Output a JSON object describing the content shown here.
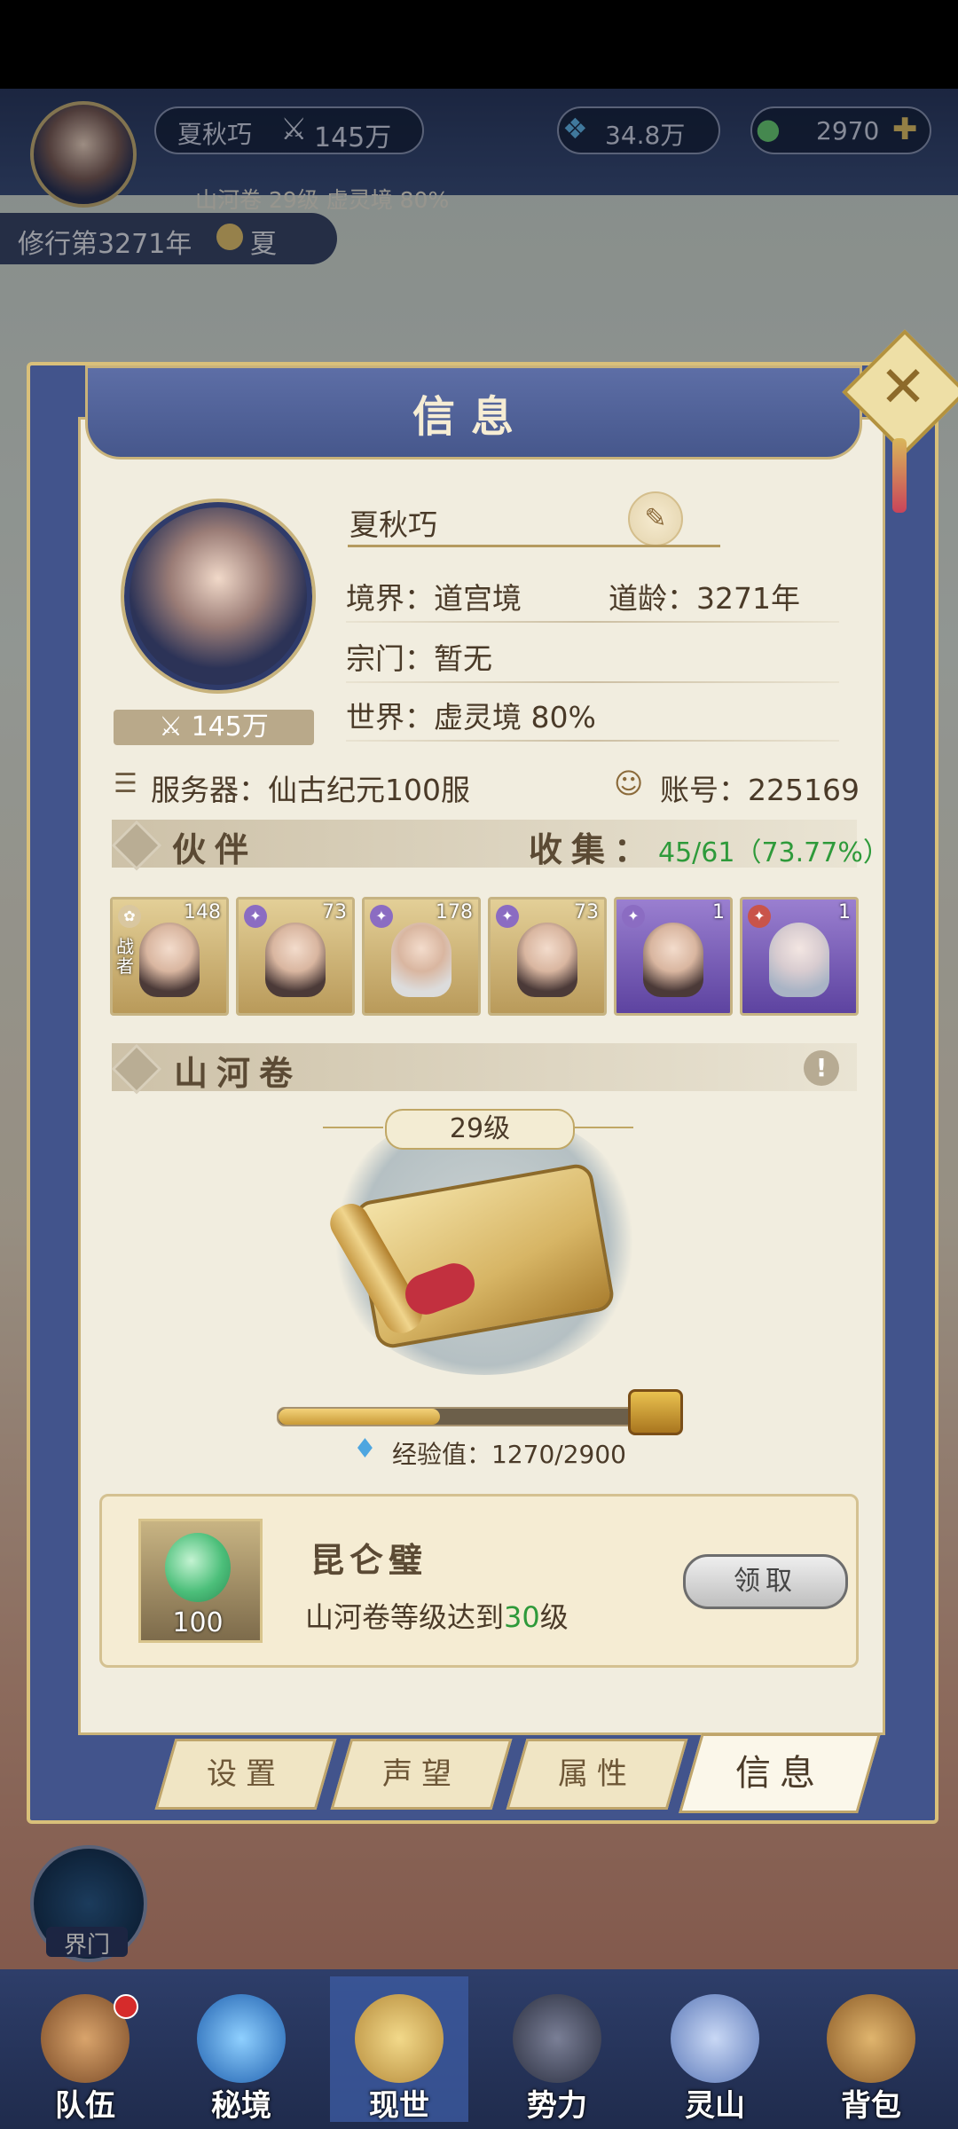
{
  "hud": {
    "player_name": "夏秋巧",
    "power": "145万",
    "spirit_stones": "34.8万",
    "jade": "2970",
    "realm_line": "山河卷 29级 虚灵境 80%",
    "year": "修行第3271年",
    "season": "夏"
  },
  "dialog": {
    "title": "信息",
    "name": "夏秋巧",
    "realm": "境界：道宫境",
    "age": "道龄：3271年",
    "sect": "宗门：暂无",
    "world": "世界：虚灵境  80%",
    "power_badge": "145万",
    "server": "服务器：仙古纪元100服",
    "account": "账号：225169",
    "companions_title": "伙伴",
    "collect_label": "收集：",
    "collect_value": "45/61（73.77%）",
    "companions": [
      {
        "level": "148",
        "tag": "战者",
        "bg": "#c9b27a"
      },
      {
        "level": "73",
        "tag": "",
        "bg": "#c9b27a"
      },
      {
        "level": "178",
        "tag": "",
        "bg": "#c9b27a"
      },
      {
        "level": "73",
        "tag": "",
        "bg": "#c9b27a"
      },
      {
        "level": "1",
        "tag": "",
        "bg": "#7b5fb3"
      },
      {
        "level": "1",
        "tag": "",
        "bg": "#7b5fb3"
      }
    ],
    "scroll_title": "山河卷",
    "scroll_level": "29级",
    "exp_label": "经验值：1270/2900",
    "exp_progress": 0.438,
    "reward_name": "昆仑璧",
    "reward_qty": "100",
    "reward_desc_pre": "山河卷等级达到",
    "reward_desc_num": "30",
    "reward_desc_post": "级",
    "claim": "领取"
  },
  "tabs": [
    "设置",
    "声望",
    "属性",
    "信息"
  ],
  "side": {
    "gate": "界门"
  },
  "nav": [
    {
      "label": "队伍",
      "color": "#a0653a"
    },
    {
      "label": "秘境",
      "color": "#2b72c9"
    },
    {
      "label": "现世",
      "color": "#caa35a"
    },
    {
      "label": "势力",
      "color": "#3a3f55"
    },
    {
      "label": "灵山",
      "color": "#6a86c8"
    },
    {
      "label": "背包",
      "color": "#a77a3c"
    }
  ],
  "colors": {
    "accent_gold": "#c9b37a",
    "panel": "#f1eddf",
    "green": "#2e9a3a"
  }
}
